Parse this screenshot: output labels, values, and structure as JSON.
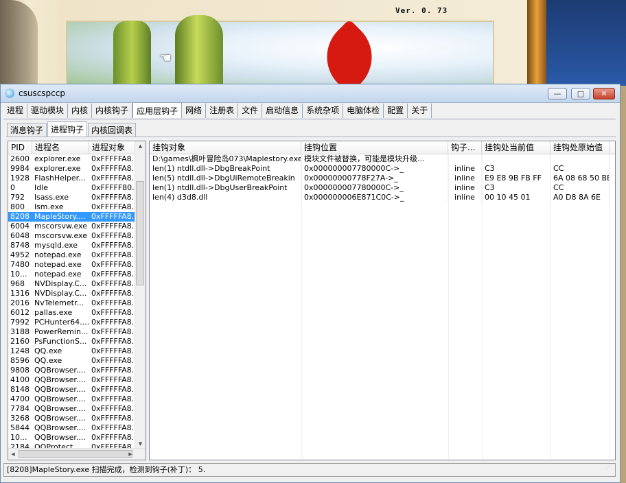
{
  "background": {
    "version_text": "Ver. 0. 73"
  },
  "window": {
    "title": "csuscspccp",
    "caption_buttons": {
      "minimize": "—",
      "maximize": "□",
      "close": "✕"
    }
  },
  "main_tabs": [
    {
      "label": "进程",
      "active": false
    },
    {
      "label": "驱动模块",
      "active": false
    },
    {
      "label": "内核",
      "active": false
    },
    {
      "label": "内核钩子",
      "active": false
    },
    {
      "label": "应用层钩子",
      "active": true
    },
    {
      "label": "网络",
      "active": false
    },
    {
      "label": "注册表",
      "active": false
    },
    {
      "label": "文件",
      "active": false
    },
    {
      "label": "启动信息",
      "active": false
    },
    {
      "label": "系统杂项",
      "active": false
    },
    {
      "label": "电脑体检",
      "active": false
    },
    {
      "label": "配置",
      "active": false
    },
    {
      "label": "关于",
      "active": false
    }
  ],
  "sub_tabs": [
    {
      "label": "消息钩子",
      "active": false
    },
    {
      "label": "进程钩子",
      "active": true
    },
    {
      "label": "内核回调表",
      "active": false
    }
  ],
  "process_list": {
    "columns": [
      "PID",
      "进程名",
      "进程对象"
    ],
    "selected_index": 6,
    "rows": [
      [
        "2600",
        "explorer.exe",
        "0xFFFFFA8..."
      ],
      [
        "9984",
        "explorer.exe",
        "0xFFFFFA8..."
      ],
      [
        "1928",
        "FlashHelper...",
        "0xFFFFFA8..."
      ],
      [
        "0",
        "Idle",
        "0xFFFFF80..."
      ],
      [
        "792",
        "lsass.exe",
        "0xFFFFFA8..."
      ],
      [
        "800",
        "lsm.exe",
        "0xFFFFFA8..."
      ],
      [
        "8208",
        "MapleStory....",
        "0xFFFFFA8..."
      ],
      [
        "6004",
        "mscorsvw.exe",
        "0xFFFFFA8..."
      ],
      [
        "6048",
        "mscorsvw.exe",
        "0xFFFFFA8..."
      ],
      [
        "8748",
        "mysqld.exe",
        "0xFFFFFA8..."
      ],
      [
        "4952",
        "notepad.exe",
        "0xFFFFFA8..."
      ],
      [
        "7480",
        "notepad.exe",
        "0xFFFFFA8..."
      ],
      [
        "10...",
        "notepad.exe",
        "0xFFFFFA8..."
      ],
      [
        "968",
        "NVDisplay.C...",
        "0xFFFFFA8..."
      ],
      [
        "1316",
        "NVDisplay.C...",
        "0xFFFFFA8..."
      ],
      [
        "2016",
        "NvTelemetr...",
        "0xFFFFFA8..."
      ],
      [
        "6012",
        "pallas.exe",
        "0xFFFFFA8..."
      ],
      [
        "7992",
        "PCHunter64....",
        "0xFFFFFA8..."
      ],
      [
        "3188",
        "PowerRemin...",
        "0xFFFFFA8..."
      ],
      [
        "2160",
        "PsFunctionS...",
        "0xFFFFFA8..."
      ],
      [
        "1248",
        "QQ.exe",
        "0xFFFFFA8..."
      ],
      [
        "8596",
        "QQ.exe",
        "0xFFFFFA8..."
      ],
      [
        "9808",
        "QQBrowser....",
        "0xFFFFFA8..."
      ],
      [
        "4100",
        "QQBrowser....",
        "0xFFFFFA8..."
      ],
      [
        "8148",
        "QQBrowser....",
        "0xFFFFFA8..."
      ],
      [
        "4700",
        "QQBrowser....",
        "0xFFFFFA8..."
      ],
      [
        "7784",
        "QQBrowser....",
        "0xFFFFFA8..."
      ],
      [
        "3268",
        "QQBrowser....",
        "0xFFFFFA8..."
      ],
      [
        "5844",
        "QQBrowser....",
        "0xFFFFFA8..."
      ],
      [
        "10...",
        "QQBrowser....",
        "0xFFFFFA8..."
      ],
      [
        "2184",
        "QQProtect....",
        "0xFFFFFA8..."
      ]
    ]
  },
  "hook_list": {
    "columns": [
      "挂钩对象",
      "挂钩位置",
      "钩子...",
      "挂钩处当前值",
      "挂钩处原始值"
    ],
    "rows": [
      [
        "D:\\games\\枫叶冒险岛073\\Maplestory.exe",
        "模块文件被替换，可能是模块升级...",
        "",
        "",
        ""
      ],
      [
        "len(1) ntdll.dll->DbgBreakPoint",
        "0x000000007780000C->_",
        "inline",
        "C3",
        "CC"
      ],
      [
        "len(5) ntdll.dll->DbgUiRemoteBreakin",
        "0x00000000778F27A->_",
        "inline",
        "E9 E8 9B FB FF",
        "6A 08 68 50 BB"
      ],
      [
        "len(1) ntdll.dll->DbgUserBreakPoint",
        "0x000000007780000C->_",
        "inline",
        "C3",
        "CC"
      ],
      [
        "len(4) d3d8.dll",
        "0x000000006E871C0C->_",
        "inline",
        "00 10 45 01",
        "A0 D8 8A 6E"
      ]
    ]
  },
  "status": {
    "text": "[8208]MapleStory.exe 扫描完成，检测到钩子(补丁)： 5."
  },
  "colors": {
    "selection": "#3399ff",
    "tab_border": "#9aa6b6"
  }
}
